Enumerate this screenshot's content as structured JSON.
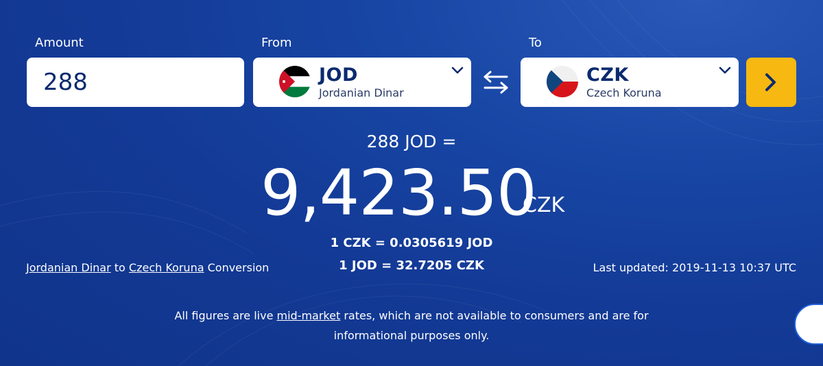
{
  "converter": {
    "amount_label": "Amount",
    "amount_value": "288",
    "from_label": "From",
    "from_code": "JOD",
    "from_name": "Jordanian Dinar",
    "to_label": "To",
    "to_code": "CZK",
    "to_name": "Czech Koruna"
  },
  "result": {
    "source": "288 JOD =",
    "value": "9,423.50",
    "currency": "CZK",
    "rate_inverse": "1 CZK = 0.0305619 JOD",
    "rate_direct": "1 JOD = 32.7205 CZK"
  },
  "footer": {
    "conversion_from": "Jordanian Dinar",
    "conversion_to_word": "to",
    "conversion_to": "Czech Koruna",
    "conversion_suffix": "Conversion",
    "last_updated": "Last updated: 2019-11-13 10:37 UTC",
    "disclaimer_prefix": "All figures are live",
    "disclaimer_link": "mid-market",
    "disclaimer_suffix": "rates, which are not available to consumers and are for informational purposes only."
  },
  "colors": {
    "background": "#133a96",
    "accent_button": "#f6b811",
    "text_dark": "#0b2a6f"
  },
  "icons": {
    "swap": "swap-arrows-icon",
    "chevron": "chevron-down-icon",
    "go": "chevron-right-icon"
  }
}
